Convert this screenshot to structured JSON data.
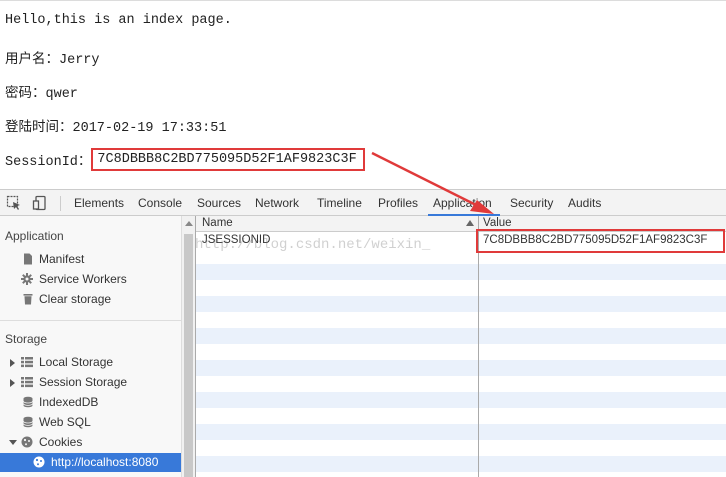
{
  "page": {
    "greeting": "Hello,this is an index page.",
    "username_label": "用户名：",
    "username": "Jerry",
    "password_label": "密码：",
    "password": "qwer",
    "login_time_label": "登陆时间：",
    "login_time": "2017-02-19 17:33:51",
    "session_label": "SessionId：",
    "session_id": "7C8DBBB8C2BD775095D52F1AF9823C3F"
  },
  "devtools": {
    "tabs": [
      "Elements",
      "Console",
      "Sources",
      "Network",
      "Timeline",
      "Profiles",
      "Application",
      "Security",
      "Audits"
    ],
    "active_tab": "Application"
  },
  "sidebar": {
    "application_header": "Application",
    "application_items": [
      {
        "label": "Manifest",
        "icon": "document-icon"
      },
      {
        "label": "Service Workers",
        "icon": "gear-icon"
      },
      {
        "label": "Clear storage",
        "icon": "trash-icon"
      }
    ],
    "storage_header": "Storage",
    "storage_items": [
      {
        "label": "Local Storage",
        "icon": "grid-icon"
      },
      {
        "label": "Session Storage",
        "icon": "grid-icon"
      },
      {
        "label": "IndexedDB",
        "icon": "database-icon"
      },
      {
        "label": "Web SQL",
        "icon": "database-icon"
      },
      {
        "label": "Cookies",
        "icon": "cookie-icon"
      },
      {
        "label": "http://localhost:8080",
        "icon": "cookie-icon",
        "selected": true
      }
    ]
  },
  "cookies_table": {
    "columns": [
      "Name",
      "Value"
    ],
    "rows": [
      {
        "name": "JSESSIONID",
        "value": "7C8DBBB8C2BD775095D52F1AF9823C3F"
      }
    ]
  },
  "watermark": "http://blog.csdn.net/weixin_",
  "colors": {
    "highlight_red": "#e03a3a",
    "selection_blue": "#3879d9",
    "stripe_blue": "#eaf1fb"
  }
}
